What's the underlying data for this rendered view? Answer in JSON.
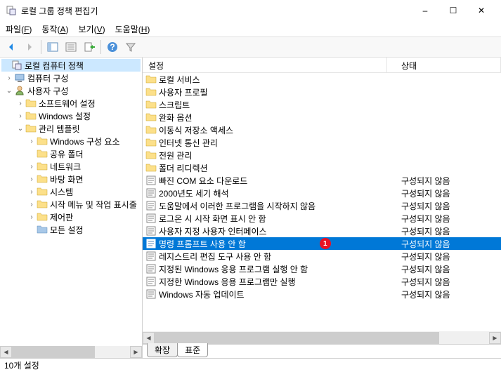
{
  "window": {
    "title": "로컬 그룹 정책 편집기",
    "minimize": "–",
    "maximize": "☐",
    "close": "✕"
  },
  "menu": {
    "file": "파일(F)",
    "action": "동작(A)",
    "view": "보기(V)",
    "help": "도움말(H)"
  },
  "tree": {
    "root": "로컬 컴퓨터 정책",
    "computer": "컴퓨터 구성",
    "user": "사용자 구성",
    "software": "소프트웨어 설정",
    "windows": "Windows 설정",
    "admin_templates": "관리 템플릿",
    "win_components": "Windows 구성 요소",
    "shared_folders": "공유 폴더",
    "network": "네트워크",
    "desktop": "바탕 화면",
    "system": "시스템",
    "start_taskbar": "시작 메뉴 및 작업 표시줄",
    "control_panel": "제어판",
    "all_settings": "모든 설정"
  },
  "list": {
    "header_setting": "설정",
    "header_state": "상태",
    "state_not_configured": "구성되지 않음",
    "items": [
      {
        "type": "folder",
        "name": "로컬 서비스",
        "state": ""
      },
      {
        "type": "folder",
        "name": "사용자 프로필",
        "state": ""
      },
      {
        "type": "folder",
        "name": "스크립트",
        "state": ""
      },
      {
        "type": "folder",
        "name": "완화 옵션",
        "state": ""
      },
      {
        "type": "folder",
        "name": "이동식 저장소 액세스",
        "state": ""
      },
      {
        "type": "folder",
        "name": "인터넷 통신 관리",
        "state": ""
      },
      {
        "type": "folder",
        "name": "전원 관리",
        "state": ""
      },
      {
        "type": "folder",
        "name": "폴더 리디렉션",
        "state": ""
      },
      {
        "type": "setting",
        "name": "빠진 COM 요소 다운로드",
        "state": "구성되지 않음"
      },
      {
        "type": "setting",
        "name": "2000년도 세기 해석",
        "state": "구성되지 않음"
      },
      {
        "type": "setting",
        "name": "도움말에서 이러한 프로그램을 시작하지 않음",
        "state": "구성되지 않음"
      },
      {
        "type": "setting",
        "name": "로그온 시 시작 화면 표시 안 함",
        "state": "구성되지 않음"
      },
      {
        "type": "setting",
        "name": "사용자 지정 사용자 인터페이스",
        "state": "구성되지 않음"
      },
      {
        "type": "setting",
        "name": "명령 프롬프트 사용 안 함",
        "state": "구성되지 않음",
        "selected": true,
        "callout": "1"
      },
      {
        "type": "setting",
        "name": "레지스트리 편집 도구 사용 안 함",
        "state": "구성되지 않음"
      },
      {
        "type": "setting",
        "name": "지정된 Windows 응용 프로그램 실행 안 함",
        "state": "구성되지 않음"
      },
      {
        "type": "setting",
        "name": "지정한 Windows 응용 프로그램만 실행",
        "state": "구성되지 않음"
      },
      {
        "type": "setting",
        "name": "Windows 자동 업데이트",
        "state": "구성되지 않음"
      }
    ]
  },
  "tabs": {
    "extended": "확장",
    "standard": "표준"
  },
  "status": {
    "text": "10개 설정"
  }
}
